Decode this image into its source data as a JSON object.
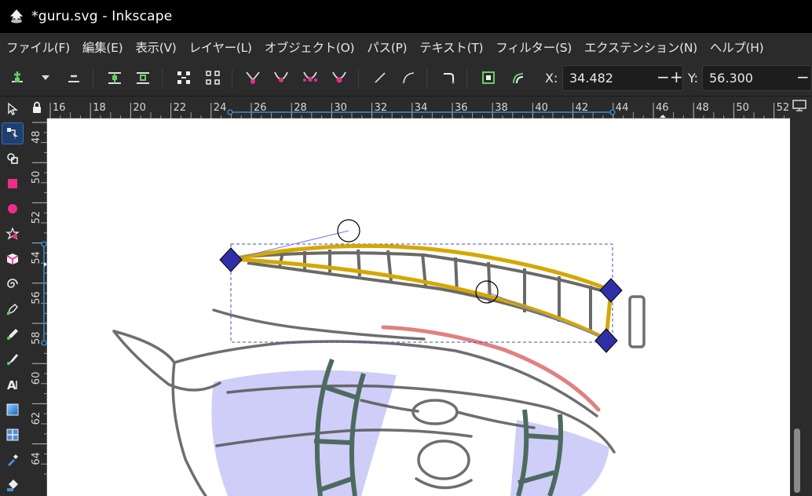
{
  "window": {
    "title": "*guru.svg - Inkscape"
  },
  "menu": [
    "ファイル(F)",
    "編集(E)",
    "表示(V)",
    "レイヤー(L)",
    "オブジェクト(O)",
    "パス(P)",
    "テキスト(T)",
    "フィルター(S)",
    "エクステンション(N)",
    "ヘルプ(H)"
  ],
  "toolbar": {
    "x_label": "X:",
    "x_value": "34.482",
    "y_label": "Y:",
    "y_value": "56.300",
    "minus": "−",
    "plus": "+"
  },
  "rulers": {
    "horizontal": [
      "16",
      "18",
      "20",
      "22",
      "24",
      "26",
      "28",
      "30",
      "32",
      "34",
      "36",
      "38",
      "40",
      "42",
      "44",
      "46",
      "48",
      "50",
      "52"
    ],
    "vertical": [
      "48",
      "50",
      "52",
      "54",
      "56",
      "58",
      "60",
      "62",
      "64"
    ]
  },
  "tools": [
    "selector-tool",
    "node-tool",
    "tweak-tool",
    "rectangle-tool",
    "ellipse-tool",
    "star-tool",
    "box-3d-tool",
    "spiral-tool",
    "pen-tool",
    "pencil-tool",
    "calligraphy-tool",
    "text-tool",
    "gradient-tool",
    "mesh-tool",
    "dropper-tool",
    "paint-bucket-tool"
  ],
  "colors": {
    "selected_path": "#d4a800",
    "node": "#2f2fa8",
    "handle_line": "#6b7cf0",
    "sketch": "#555555",
    "red_stroke": "#de7a78",
    "green_stroke": "#4d6a5f",
    "lavender_fill": "#c9c9f7"
  }
}
